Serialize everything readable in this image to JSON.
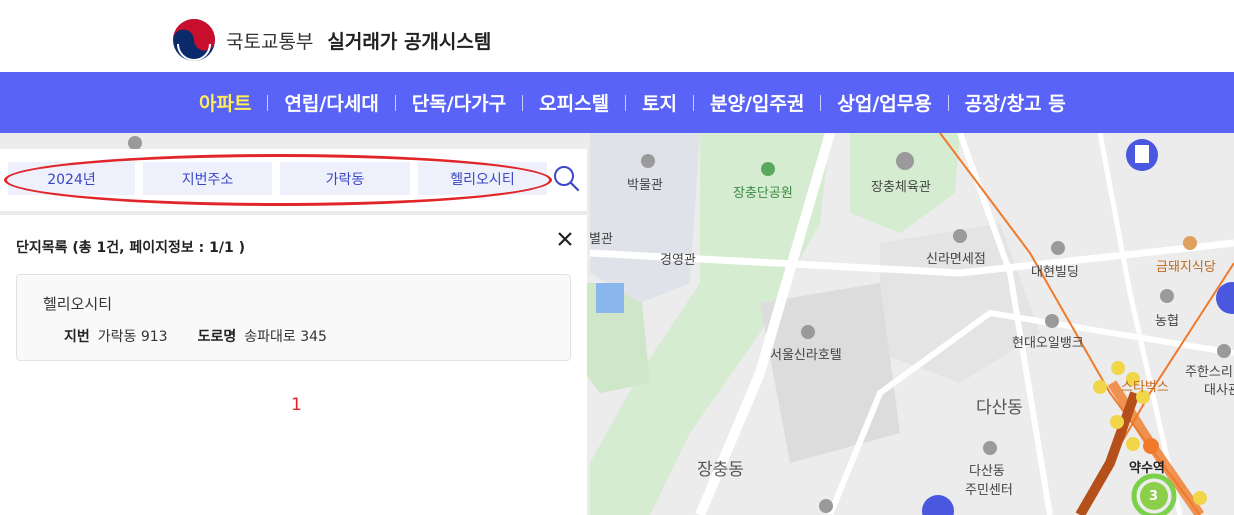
{
  "header": {
    "ministry": "국토교통부",
    "system_name": "실거래가 공개시스템"
  },
  "nav": {
    "items": [
      {
        "label": "아파트",
        "active": true
      },
      {
        "label": "연립/다세대"
      },
      {
        "label": "단독/다가구"
      },
      {
        "label": "오피스텔"
      },
      {
        "label": "토지"
      },
      {
        "label": "분양/입주권"
      },
      {
        "label": "상업/업무용"
      },
      {
        "label": "공장/창고 등"
      }
    ]
  },
  "filters": {
    "year": "2024년",
    "address_type": "지번주소",
    "dong": "가락동",
    "complex": "헬리오시티"
  },
  "result": {
    "title": "단지목록 (총 1건, 페이지정보 : 1/1 )",
    "items": [
      {
        "name": "헬리오시티",
        "jibun_label": "지번",
        "jibun_value": "가락동 913",
        "road_label": "도로명",
        "road_value": "송파대로 345"
      }
    ],
    "page": "1"
  },
  "map": {
    "labels": {
      "museum": "박물관",
      "park": "장충단공원",
      "gym": "장충체육관",
      "annex": "별관",
      "gyeongyeonggwan": "경영관",
      "shilla_duty_free": "신라면세점",
      "daehyun_building": "대현빌딩",
      "geumdwaeji": "금돼지식당",
      "nonghyup": "농협",
      "hyundai_oilbank": "현대오일뱅크",
      "shilla_hotel": "서울신라호텔",
      "dasan_dong": "다산동",
      "jangchung_dong": "장충동",
      "dasan_center_1": "다산동",
      "dasan_center_2": "주민센터",
      "yaksu_station": "약수역",
      "juhansuri_1": "주한스리",
      "juhansuri_2": "대사관",
      "starbucks": "스타벅스",
      "station_badge": "3"
    }
  },
  "colors": {
    "nav_bg": "#5a63f8",
    "nav_active": "#ffee58",
    "chip_bg": "#eef0fb",
    "chip_text": "#3a47c8",
    "highlight": "#e0262b",
    "park_green": "#d5ecd0",
    "line3_orange": "#f07a2a",
    "line6_brown": "#b5501a"
  },
  "icons": [
    "search-icon",
    "close-icon",
    "ministry-logo",
    "apartment-marker-icon"
  ]
}
